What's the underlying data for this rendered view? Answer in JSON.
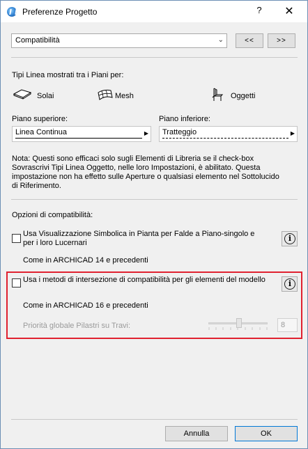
{
  "window": {
    "title": "Preferenze Progetto",
    "help_label": "?",
    "close_label": "✕",
    "icon": "archicad-app-icon"
  },
  "pref_select": {
    "value": "Compatibilità",
    "prev_label": "<<",
    "next_label": ">>"
  },
  "line_types": {
    "heading": "Tipi Linea mostrati tra i Piani per:",
    "items": [
      {
        "label": "Solai",
        "icon": "slab-icon"
      },
      {
        "label": "Mesh",
        "icon": "mesh-icon"
      },
      {
        "label": "Oggetti",
        "icon": "chair-object-icon"
      }
    ],
    "upper_label": "Piano superiore:",
    "upper_value": "Linea Continua",
    "lower_label": "Piano inferiore:",
    "lower_value": "Tratteggio",
    "note": "Nota: Questi sono efficaci solo sugli Elementi di Libreria se il check-box Sovrascrivi Tipi Linea Oggetto, nelle loro Impostazioni, è abilitato. Questa impostazione non ha effetto sulle Aperture o qualsiasi elemento nel Sottolucido di Riferimento."
  },
  "compat": {
    "heading": "Opzioni di compatibilità:",
    "option1_label": "Usa Visualizzazione Simbolica in Pianta per Falde a Piano-singolo e per i loro Lucernari",
    "option1_checked": false,
    "option1_note": "Come in ARCHICAD 14 e precedenti",
    "option2_label": "Usa i metodi di intersezione di compatibilità per gli elementi del modello",
    "option2_checked": false,
    "option2_note": "Come in ARCHICAD 16 e precedenti",
    "priority_label": "Priorità globale Pilastri su Travi:",
    "priority_value": "8",
    "info_label": "i"
  },
  "footer": {
    "cancel_label": "Annulla",
    "ok_label": "OK"
  }
}
